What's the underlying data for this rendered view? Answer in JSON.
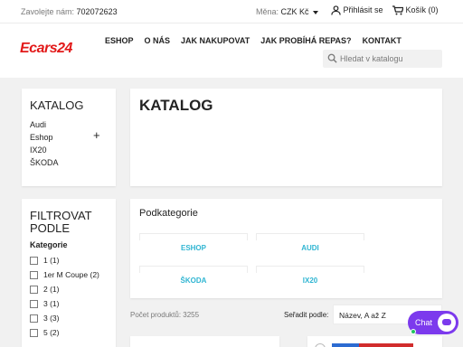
{
  "topbar": {
    "phone_label": "Zavolejte nám:",
    "phone_number": "702072623",
    "currency_label": "Měna:",
    "currency_value": "CZK Kč",
    "login": "Přihlásit se",
    "cart": "Košík (0)"
  },
  "header": {
    "logo_text": "Ecars24",
    "nav": [
      "ESHOP",
      "O NÁS",
      "JAK NAKUPOVAT",
      "JAK PROBÍHÁ REPAS?",
      "KONTAKT"
    ],
    "search_placeholder": "Hledat v katalogu"
  },
  "sidebar": {
    "catalog_title": "KATALOG",
    "catalog_items": [
      "Audi",
      "Eshop",
      "IX20",
      "ŠKODA"
    ],
    "filter_title": "FILTROVAT PODLE",
    "filter_section": "Kategorie",
    "filter_items": [
      "1 (1)",
      "1er M Coupe (2)",
      "2 (1)",
      "3 (1)",
      "3 (3)",
      "5 (2)"
    ]
  },
  "main": {
    "page_title": "KATALOG",
    "subcategories_title": "Podkategorie",
    "subcategories": [
      "ESHOP",
      "AUDI",
      "ŠKODA",
      "IX20"
    ],
    "product_count": "Počet produktů: 3255",
    "sort_label": "Seřadit podle:",
    "sort_value": "Název, A až Z"
  },
  "chat": {
    "label": "Chat"
  },
  "colors": {
    "accent": "#2fb5d2",
    "logo": "#e21a1a",
    "chat": "#7c3aed",
    "online": "#22c55e"
  }
}
